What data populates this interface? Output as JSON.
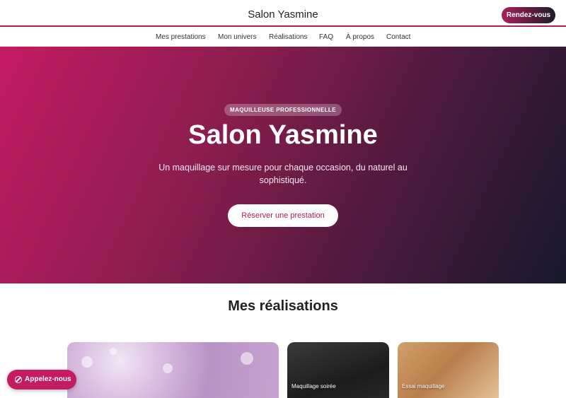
{
  "header": {
    "brand": "Salon Yasmine",
    "cta": "Rendez-vous"
  },
  "nav": {
    "items": [
      "Mes prestations",
      "Mon univers",
      "Réalisations",
      "FAQ",
      "À propos",
      "Contact"
    ]
  },
  "hero": {
    "badge": "MAQUILLEUSE PROFESSIONNELLE",
    "title": "Salon Yasmine",
    "subtitle": "Un maquillage sur mesure pour chaque occasion, du naturel au sophistiqué.",
    "button": "Réserver une prestation"
  },
  "gallery": {
    "title": "Mes réalisations",
    "cards": [
      {
        "label": ""
      },
      {
        "label": "Maquillage soirée"
      },
      {
        "label": "Essai maquillage"
      }
    ]
  },
  "call": {
    "label": "Appelez-nous",
    "icon": "phone-off-icon"
  },
  "colors": {
    "accent": "#a8205a",
    "hero_start": "#c41b62",
    "hero_end": "#17192a"
  }
}
